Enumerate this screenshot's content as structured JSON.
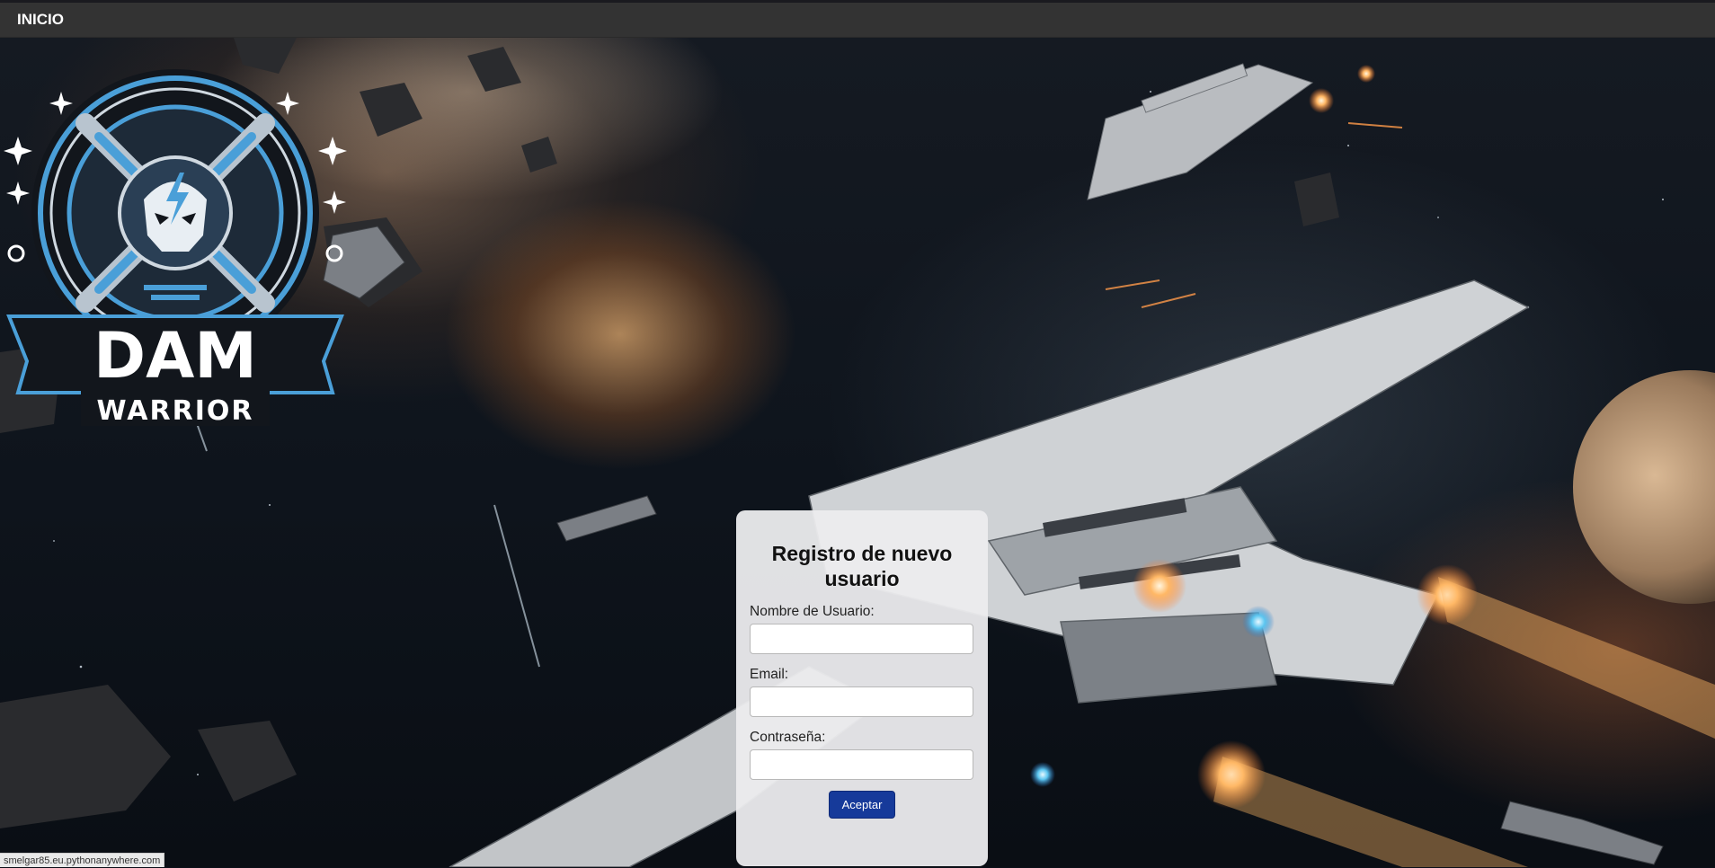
{
  "navbar": {
    "home_label": "INICIO"
  },
  "logo": {
    "title": "DAM",
    "subtitle": "WARRIOR"
  },
  "form": {
    "title": "Registro de nuevo usuario",
    "username_label": "Nombre de Usuario:",
    "username_value": "",
    "email_label": "Email:",
    "email_value": "",
    "password_label": "Contraseña:",
    "password_value": "",
    "submit_label": "Aceptar"
  },
  "status_bar": {
    "url": "smelgar85.eu.pythonanywhere.com"
  },
  "colors": {
    "navbar": "#333333",
    "submit_button": "#163a9a",
    "logo_accent": "#4a9fd8"
  }
}
